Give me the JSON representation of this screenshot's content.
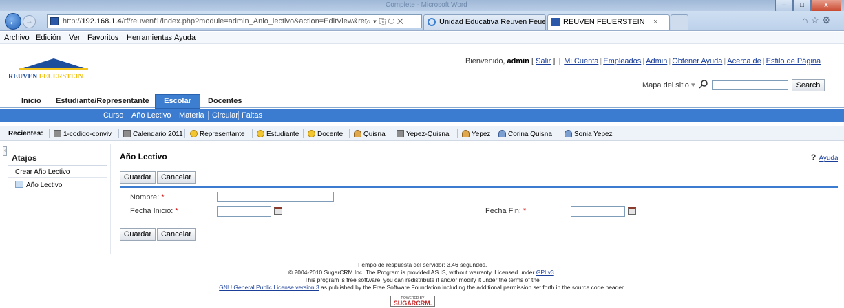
{
  "browser": {
    "window_title": "Complete - Microsoft Word",
    "url_prefix": "http://",
    "url_host": "192.168.1.4",
    "url_path": "/rf/reuvenf1/index.php?module=admin_Anio_lectivo&action=EditView&ret",
    "address_icons": "⌕ ▾ ⎘ ↻ ✕",
    "tabs": [
      {
        "label": "Unidad Educativa Reuven Feue..."
      },
      {
        "label": "REUVEN FEUERSTEIN",
        "close": "×"
      }
    ],
    "toolbar_icons": "⌂☆⚙",
    "window_controls": {
      "min": "–",
      "max": "□",
      "close": "x"
    },
    "back_glyph": "←",
    "forward_glyph": "→"
  },
  "menubar": [
    "Archivo",
    "Edición",
    "Ver",
    "Favoritos",
    "Herramientas",
    "Ayuda"
  ],
  "logo": {
    "text_a": "REUVEN ",
    "text_b": "FEUERSTEIN"
  },
  "header": {
    "welcome_prefix": "Bienvenido, ",
    "username": "admin",
    "salir_open": " [ ",
    "salir": "Salir",
    "salir_close": " ]",
    "links": [
      "Mi Cuenta",
      "Empleados",
      "Admin",
      "Obtener Ayuda",
      "Acerca de",
      "Estilo de Página"
    ],
    "sitemap": "Mapa del sitio",
    "sitemap_arrow": "▾",
    "search_button": "Search",
    "search_value": ""
  },
  "module_tabs": [
    "Inicio",
    "Estudiante/Representante",
    "Escolar",
    "Docentes"
  ],
  "sub_tabs": [
    "Curso",
    "Año Lectivo",
    "Materia",
    "Circular",
    "Faltas"
  ],
  "recents": {
    "label": "Recientes:",
    "items": [
      "1-codigo-conviv",
      "Calendario 2011",
      "Representante",
      "Estudiante",
      "Docente",
      "Quisna",
      "Yepez-Quisna",
      "Yepez",
      "Corina Quisna",
      "Sonia Yepez"
    ]
  },
  "sidebar": {
    "handle": "‹",
    "title": "Atajos",
    "create": "Crear Año Lectivo",
    "list": "Año Lectivo"
  },
  "main": {
    "title": "Año Lectivo",
    "help_mark": "?",
    "help": "Ayuda",
    "save": "Guardar",
    "cancel": "Cancelar",
    "fields": {
      "nombre_label": "Nombre:",
      "fecha_inicio_label": "Fecha Inicio:",
      "fecha_fin_label": "Fecha Fin:",
      "required_mark": "*",
      "nombre_value": "",
      "fecha_inicio_value": "",
      "fecha_fin_value": ""
    }
  },
  "footer": {
    "line1": "Tiempo de respuesta del servidor: 3.46 segundos.",
    "line2_a": "© 2004-2010 SugarCRM Inc. The Program is provided AS IS, without warranty. Licensed under ",
    "line2_link": "GPLv3",
    "line2_b": ".",
    "line3": "This program is free software; you can redistribute it and/or modify it under the terms of the",
    "line4_link": "GNU General Public License version 3",
    "line4_b": " as published by the Free Software Foundation including the additional permission set forth in the source code header.",
    "powered_by": "POWERED BY",
    "sugar": "SUGARCRM."
  }
}
